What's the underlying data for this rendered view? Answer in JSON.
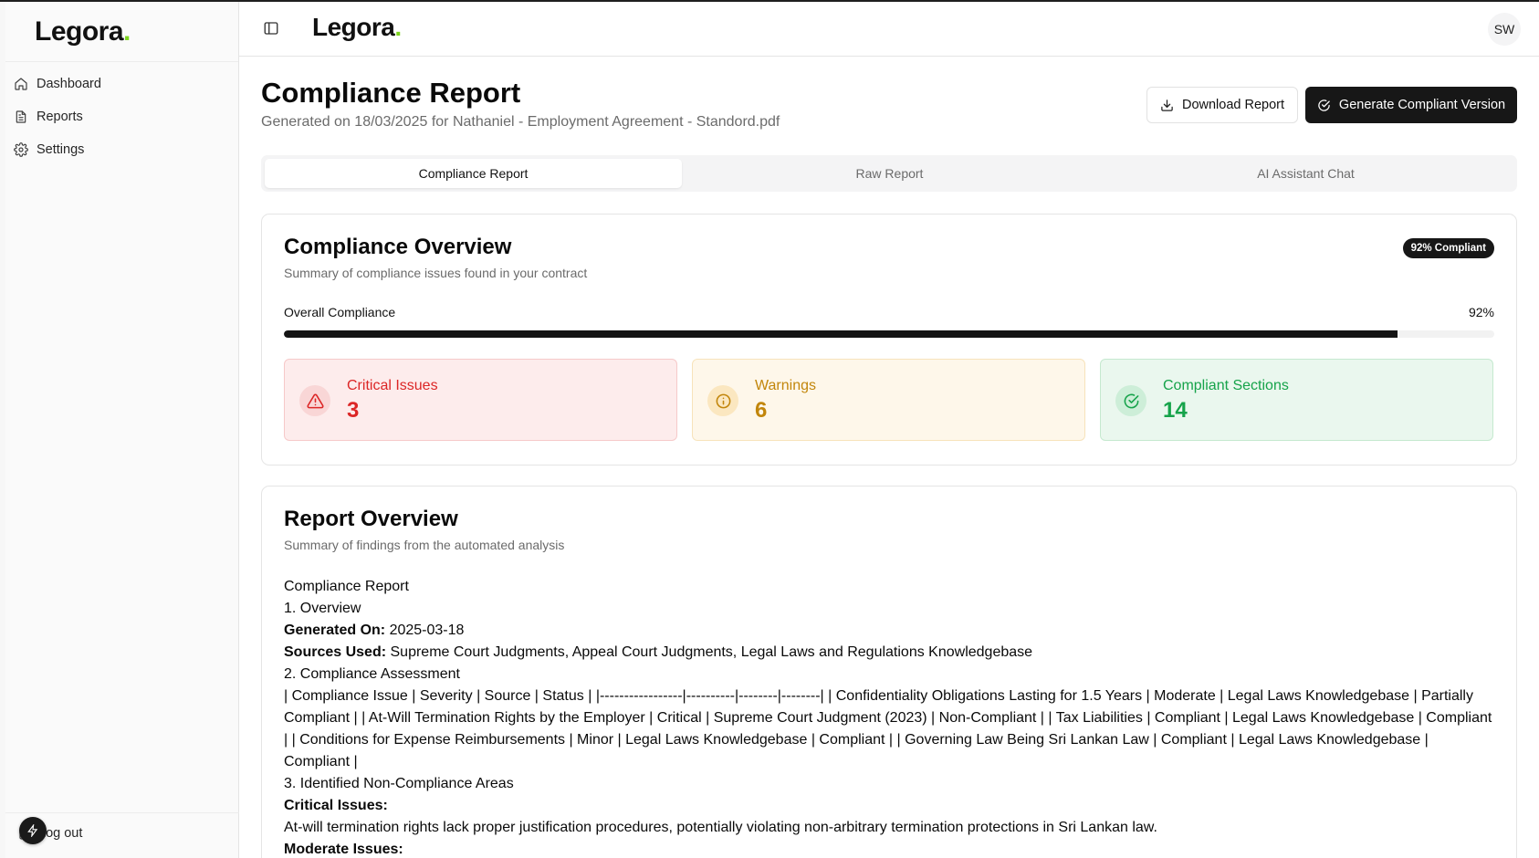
{
  "brand": {
    "name": "Legora",
    "dot": "."
  },
  "sidebar": {
    "items": [
      {
        "label": "Dashboard",
        "icon": "home-icon"
      },
      {
        "label": "Reports",
        "icon": "file-text-icon"
      },
      {
        "label": "Settings",
        "icon": "gear-icon"
      }
    ],
    "logout_label": "Log out"
  },
  "header": {
    "avatar_initials": "SW"
  },
  "page": {
    "title": "Compliance Report",
    "subtitle": "Generated on 18/03/2025 for Nathaniel - Employment Agreement - Standord.pdf",
    "download_label": "Download Report",
    "generate_label": "Generate Compliant Version"
  },
  "tabs": [
    {
      "label": "Compliance Report",
      "active": true
    },
    {
      "label": "Raw Report",
      "active": false
    },
    {
      "label": "AI Assistant Chat",
      "active": false
    }
  ],
  "overview": {
    "title": "Compliance Overview",
    "description": "Summary of compliance issues found in your contract",
    "badge": "92% Compliant",
    "progress_label": "Overall Compliance",
    "progress_text": "92%",
    "progress_value": 92,
    "stats": [
      {
        "label": "Critical Issues",
        "value": "3",
        "icon": "alert-triangle-icon",
        "color": "#dc2626"
      },
      {
        "label": "Warnings",
        "value": "6",
        "icon": "info-circle-icon",
        "color": "#c2860b"
      },
      {
        "label": "Compliant Sections",
        "value": "14",
        "icon": "check-circle-icon",
        "color": "#16a34a"
      }
    ]
  },
  "report": {
    "title": "Report Overview",
    "description": "Summary of findings from the automated analysis",
    "lines": {
      "l1": "Compliance Report",
      "l2": "1. Overview",
      "generated_key": "Generated On:",
      "generated_val": " 2025-03-18",
      "sources_key": "Sources Used:",
      "sources_val": " Supreme Court Judgments, Appeal Court Judgments, Legal Laws and Regulations Knowledgebase",
      "l5": "2. Compliance Assessment",
      "table": "| Compliance Issue | Severity | Source | Status | |-----------------|----------|--------|--------| | Confidentiality Obligations Lasting for 1.5 Years | Moderate | Legal Laws Knowledgebase | Partially Compliant | | At-Will Termination Rights by the Employer | Critical | Supreme Court Judgment (2023) | Non-Compliant | | Tax Liabilities | Compliant | Legal Laws Knowledgebase | Compliant | | Conditions for Expense Reimbursements | Minor | Legal Laws Knowledgebase | Compliant | | Governing Law Being Sri Lankan Law | Compliant | Legal Laws Knowledgebase | Compliant |",
      "l7": "3. Identified Non-Compliance Areas",
      "critical_key": "Critical Issues:",
      "critical_text": "At-will termination rights lack proper justification procedures, potentially violating non-arbitrary termination protections in Sri Lankan law.",
      "moderate_key": "Moderate Issues:"
    }
  }
}
